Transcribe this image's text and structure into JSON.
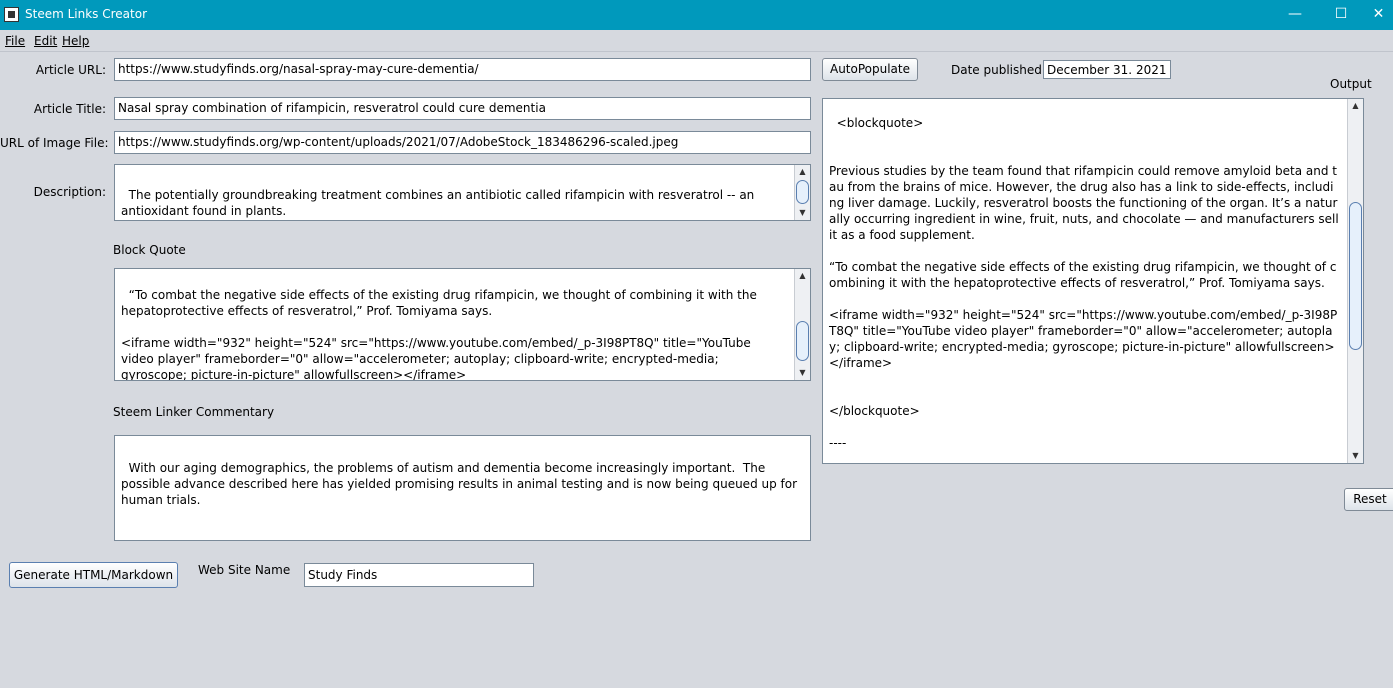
{
  "window": {
    "title": "Steem Links Creator",
    "minimize": "—",
    "maximize": "☐",
    "close": "✕"
  },
  "menu": {
    "file": "File",
    "edit": "Edit",
    "help": "Help"
  },
  "form": {
    "article_url_label": "Article URL:",
    "article_url_value": "https://www.studyfinds.org/nasal-spray-may-cure-dementia/",
    "article_title_label": "Article Title:",
    "article_title_value": "Nasal spray combination of rifampicin, resveratrol could cure dementia",
    "image_url_label": "URL of Image File:",
    "image_url_value": "https://www.studyfinds.org/wp-content/uploads/2021/07/AdobeStock_183486296-scaled.jpeg",
    "description_label": "Description:",
    "description_value": "The potentially groundbreaking treatment combines an antibiotic called rifampicin with resveratrol -- an antioxidant found in plants.",
    "block_quote_label": "Block Quote",
    "block_quote_value": "“To combat the negative side effects of the existing drug rifampicin, we thought of combining it with the hepatoprotective effects of resveratrol,” Prof. Tomiyama says.\n\n<iframe width=\"932\" height=\"524\" src=\"https://www.youtube.com/embed/_p-3I98PT8Q\" title=\"YouTube video player\" frameborder=\"0\" allow=\"accelerometer; autoplay; clipboard-write; encrypted-media; gyroscope; picture-in-picture\" allowfullscreen></iframe>",
    "commentary_label": "Steem Linker Commentary",
    "commentary_value": "With our aging demographics, the problems of autism and dementia become increasingly important.  The possible advance described here has yielded promising results in animal testing and is now being queued up for human trials.",
    "autopopulate_label": "AutoPopulate",
    "date_published_label": "Date published",
    "date_published_value": "December 31. 2021",
    "output_label": "Output",
    "output_value": "<blockquote>\n\n\nPrevious studies by the team found that rifampicin could remove amyloid beta and tau from the brains of mice. However, the drug also has a link to side-effects, including liver damage. Luckily, resveratrol boosts the functioning of the organ. It’s a naturally occurring ingredient in wine, fruit, nuts, and chocolate — and manufacturers sell it as a food supplement.\n\n“To combat the negative side effects of the existing drug rifampicin, we thought of combining it with the hepatoprotective effects of resveratrol,” Prof. Tomiyama says.\n\n<iframe width=\"932\" height=\"524\" src=\"https://www.youtube.com/embed/_p-3I98PT8Q\" title=\"YouTube video player\" frameborder=\"0\" allow=\"accelerometer; autoplay; clipboard-write; encrypted-media; gyroscope; picture-in-picture\" allowfullscreen></iframe>\n\n\n</blockquote>\n\n----\n\nWith our aging demographics, the problems of autism and dementia become increasingly important.  The possible advance described here has yielded promising results in animal testing and is now being queued up for human trials.",
    "reset_label": "Reset",
    "generate_label": "Generate HTML/Markdown",
    "website_name_label": "Web Site Name",
    "website_name_value": "Study Finds"
  },
  "colors": {
    "titlebar": "#0099bc",
    "background": "#d6d9df"
  }
}
